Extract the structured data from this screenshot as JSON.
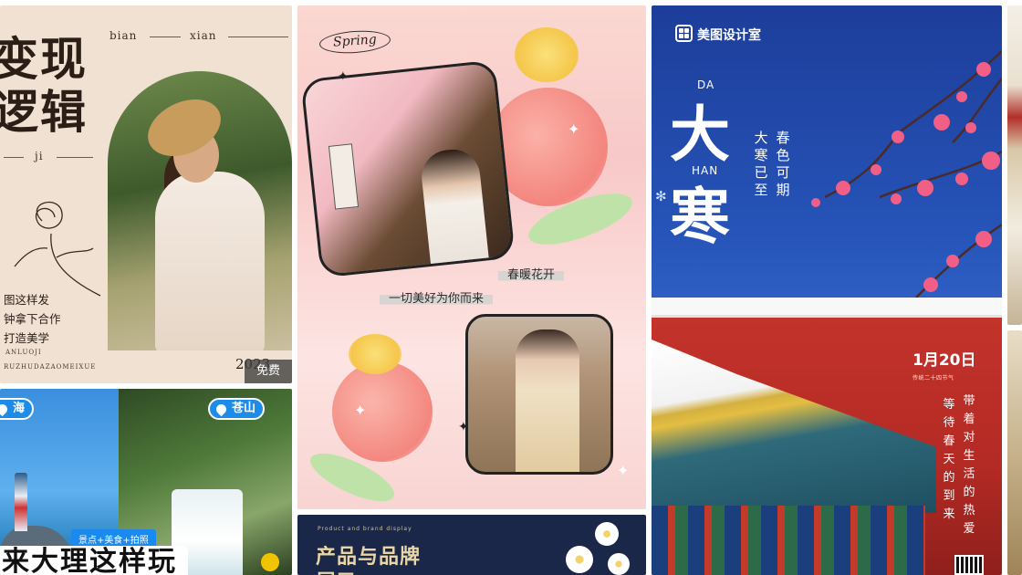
{
  "card1": {
    "title_line1": "变现",
    "title_line2": "逻辑",
    "py_bian": "bian",
    "py_xian": "xian",
    "py_ji": "ji",
    "body_lines": [
      "图这样发",
      "钟拿下合作",
      "打造美学"
    ],
    "sub_line1": "ANLUOJI",
    "sub_line2": "RUZHUDAZAOMEIXUE",
    "year": "2023",
    "badge": "免费"
  },
  "card2": {
    "pin_left": "海",
    "pin_right": "苍山",
    "tags": "景点+美食+拍照",
    "headline": "来大理这样玩"
  },
  "card3": {
    "spring_label": "Spring",
    "caption1": "春暖花开",
    "caption2": "一切美好为你而来"
  },
  "card4": {
    "small_label": "Product and brand display",
    "title_line1": "产品与品牌",
    "title_line2": "展示"
  },
  "card5": {
    "brand": "美图设计室",
    "py_da": "DA",
    "hz_da": "大",
    "py_han": "HAN",
    "hz_han": "寒",
    "vert_a": "大寒已至",
    "vert_b": "春色可期",
    "date": "1月20日",
    "date_sub": "传统二十四节气",
    "col1": "等待春天的到来",
    "col2": "带着对生活的热爱",
    "colors": {
      "sky": "#1d3d9a",
      "wall": "#b42a24",
      "blossom": "#f25f86"
    }
  }
}
